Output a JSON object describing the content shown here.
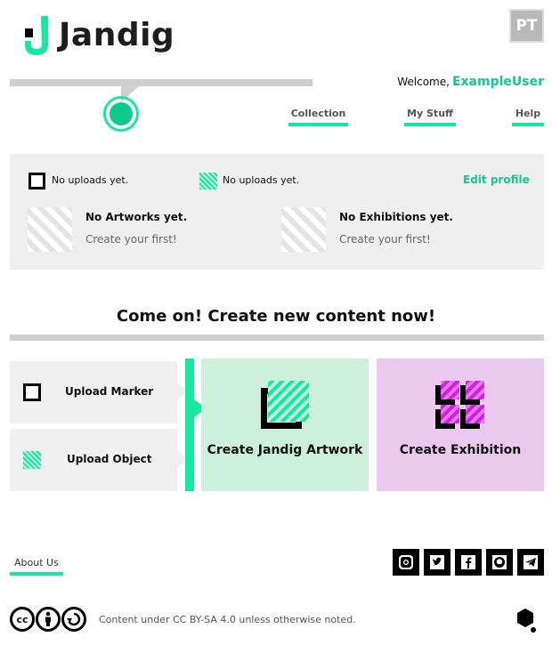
{
  "header": {
    "logo_text": "Jandig",
    "language_button": "PT",
    "welcome_label": "Welcome,",
    "username": "ExampleUser"
  },
  "nav": {
    "collection": "Collection",
    "my_stuff": "My Stuff",
    "help": "Help"
  },
  "profile": {
    "markers_status": "No uploads yet.",
    "objects_status": "No uploads yet.",
    "edit_profile": "Edit profile",
    "artworks_title": "No Artworks yet.",
    "artworks_sub": "Create your first!",
    "exhibitions_title": "No Exhibitions yet.",
    "exhibitions_sub": "Create your first!"
  },
  "create": {
    "heading": "Come on! Create new content now!",
    "upload_marker": "Upload Marker",
    "upload_object": "Upload Object",
    "create_artwork": "Create Jandig Artwork",
    "create_exhibition": "Create Exhibition"
  },
  "footer": {
    "about": "About Us",
    "social": [
      "instagram-icon",
      "twitter-icon",
      "facebook-icon",
      "github-icon",
      "telegram-icon"
    ],
    "license": "Content under CC BY-SA 4.0 unless otherwise noted."
  },
  "colors": {
    "accent": "#17e6a0",
    "magenta": "#d31be6",
    "panel": "#efefef"
  }
}
